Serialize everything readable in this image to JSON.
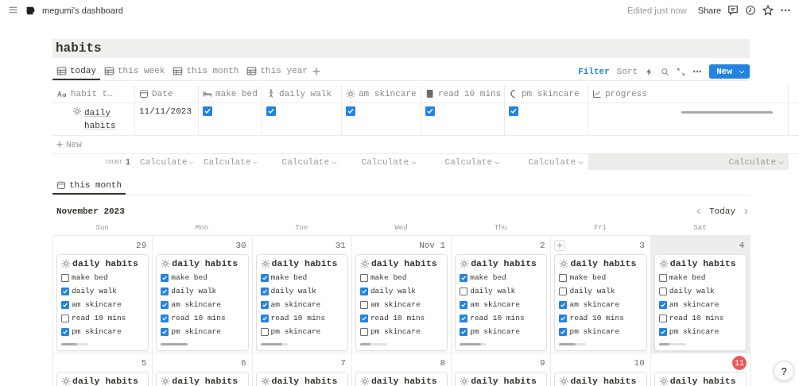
{
  "topbar": {
    "page_title": "megumi's dashboard",
    "edited": "Edited just now",
    "share": "Share"
  },
  "database": {
    "title": "habits",
    "views": [
      {
        "label": "today",
        "selected": true
      },
      {
        "label": "this week",
        "selected": false
      },
      {
        "label": "this month",
        "selected": false
      },
      {
        "label": "this year",
        "selected": false
      }
    ],
    "toolbar": {
      "filter": "Filter",
      "sort": "Sort",
      "new": "New"
    },
    "table": {
      "columns": [
        {
          "label": "habit t…",
          "kind": "title"
        },
        {
          "label": "Date",
          "kind": "date"
        },
        {
          "label": "make bed",
          "kind": "checkbox"
        },
        {
          "label": "daily walk",
          "kind": "checkbox"
        },
        {
          "label": "am skincare",
          "kind": "checkbox"
        },
        {
          "label": "read 10 mins",
          "kind": "checkbox"
        },
        {
          "label": "pm skincare",
          "kind": "checkbox"
        },
        {
          "label": "progress",
          "kind": "progress"
        }
      ],
      "rows": [
        {
          "title": "daily habits",
          "date": "11/11/2023",
          "checks": [
            true,
            true,
            true,
            true,
            true
          ],
          "level": 1
        }
      ],
      "new_row": "New",
      "footer": {
        "count_label": "COUNT",
        "count": "1",
        "calculates": [
          {
            "label": "Calculate",
            "selected": false
          },
          {
            "label": "Calculate",
            "selected": false
          },
          {
            "label": "Calculate",
            "selected": false
          },
          {
            "label": "Calculate",
            "selected": false
          },
          {
            "label": "Calculate",
            "selected": false
          },
          {
            "label": "Calculate",
            "selected": false
          },
          {
            "label": "Calculate",
            "selected": true
          }
        ]
      }
    }
  },
  "calendar": {
    "view": {
      "label": "this month",
      "selected": true
    },
    "month": "November 2023",
    "today_button": "Today",
    "weekdays": [
      "Sun",
      "Mon",
      "Tue",
      "Wed",
      "Thu",
      "Fri",
      "Sat"
    ],
    "weeks": [
      [
        {
          "day": "29",
          "today": false,
          "shaded": false,
          "add_button": false,
          "cards": [
            {
              "title": "daily habits",
              "level": 0.6,
              "habits": [
                {
                  "label": "make bed",
                  "checked": false
                },
                {
                  "label": "daily walk",
                  "checked": true
                },
                {
                  "label": "am skincare",
                  "checked": true
                },
                {
                  "label": "read 10 mins",
                  "checked": false
                },
                {
                  "label": "pm skincare",
                  "checked": true
                }
              ]
            }
          ]
        },
        {
          "day": "30",
          "today": false,
          "shaded": false,
          "add_button": false,
          "cards": [
            {
              "title": "daily habits",
              "level": 1,
              "habits": [
                {
                  "label": "make bed",
                  "checked": true
                },
                {
                  "label": "daily walk",
                  "checked": true
                },
                {
                  "label": "am skincare",
                  "checked": true
                },
                {
                  "label": "read 10 mins",
                  "checked": true
                },
                {
                  "label": "pm skincare",
                  "checked": true
                }
              ]
            }
          ]
        },
        {
          "day": "31",
          "today": false,
          "shaded": false,
          "add_button": false,
          "cards": [
            {
              "title": "daily habits",
              "level": 0.8,
              "habits": [
                {
                  "label": "make bed",
                  "checked": true
                },
                {
                  "label": "daily walk",
                  "checked": true
                },
                {
                  "label": "am skincare",
                  "checked": true
                },
                {
                  "label": "read 10 mins",
                  "checked": true
                },
                {
                  "label": "pm skincare",
                  "checked": false
                }
              ]
            }
          ]
        },
        {
          "day": "Nov 1",
          "today": false,
          "shaded": false,
          "add_button": false,
          "cards": [
            {
              "title": "daily habits",
              "level": 0.4,
              "habits": [
                {
                  "label": "make bed",
                  "checked": false
                },
                {
                  "label": "daily walk",
                  "checked": true
                },
                {
                  "label": "am skincare",
                  "checked": false
                },
                {
                  "label": "read 10 mins",
                  "checked": true
                },
                {
                  "label": "pm skincare",
                  "checked": false
                }
              ]
            }
          ]
        },
        {
          "day": "2",
          "today": false,
          "shaded": false,
          "add_button": false,
          "cards": [
            {
              "title": "daily habits",
              "level": 0.8,
              "habits": [
                {
                  "label": "make bed",
                  "checked": true
                },
                {
                  "label": "daily walk",
                  "checked": false
                },
                {
                  "label": "am skincare",
                  "checked": true
                },
                {
                  "label": "read 10 mins",
                  "checked": true
                },
                {
                  "label": "pm skincare",
                  "checked": true
                }
              ]
            }
          ]
        },
        {
          "day": "3",
          "today": false,
          "shaded": false,
          "add_button": true,
          "cards": [
            {
              "title": "daily habits",
              "level": 0.6,
              "habits": [
                {
                  "label": "make bed",
                  "checked": false
                },
                {
                  "label": "daily walk",
                  "checked": false
                },
                {
                  "label": "am skincare",
                  "checked": true
                },
                {
                  "label": "read 10 mins",
                  "checked": true
                },
                {
                  "label": "pm skincare",
                  "checked": true
                }
              ]
            }
          ]
        },
        {
          "day": "4",
          "today": false,
          "shaded": true,
          "add_button": false,
          "cards": [
            {
              "title": "daily habits",
              "level": 0.4,
              "habits": [
                {
                  "label": "make bed",
                  "checked": false
                },
                {
                  "label": "daily walk",
                  "checked": false
                },
                {
                  "label": "am skincare",
                  "checked": true
                },
                {
                  "label": "read 10 mins",
                  "checked": false
                },
                {
                  "label": "pm skincare",
                  "checked": true
                }
              ]
            }
          ]
        }
      ],
      [
        {
          "day": "5",
          "today": false,
          "shaded": false,
          "add_button": false,
          "cards": [
            {
              "title": "daily habits"
            }
          ]
        },
        {
          "day": "6",
          "today": false,
          "shaded": false,
          "add_button": false,
          "cards": [
            {
              "title": "daily habits"
            }
          ]
        },
        {
          "day": "7",
          "today": false,
          "shaded": false,
          "add_button": false,
          "cards": [
            {
              "title": "daily habits"
            }
          ]
        },
        {
          "day": "8",
          "today": false,
          "shaded": false,
          "add_button": false,
          "cards": [
            {
              "title": "daily habits"
            }
          ]
        },
        {
          "day": "9",
          "today": false,
          "shaded": false,
          "add_button": false,
          "cards": [
            {
              "title": "daily habits"
            }
          ]
        },
        {
          "day": "10",
          "today": false,
          "shaded": false,
          "add_button": false,
          "cards": [
            {
              "title": "daily habits"
            }
          ]
        },
        {
          "day": "11",
          "today": true,
          "shaded": false,
          "add_button": false,
          "cards": [
            {
              "title": "daily habits"
            }
          ]
        }
      ]
    ]
  },
  "help_button": "?"
}
